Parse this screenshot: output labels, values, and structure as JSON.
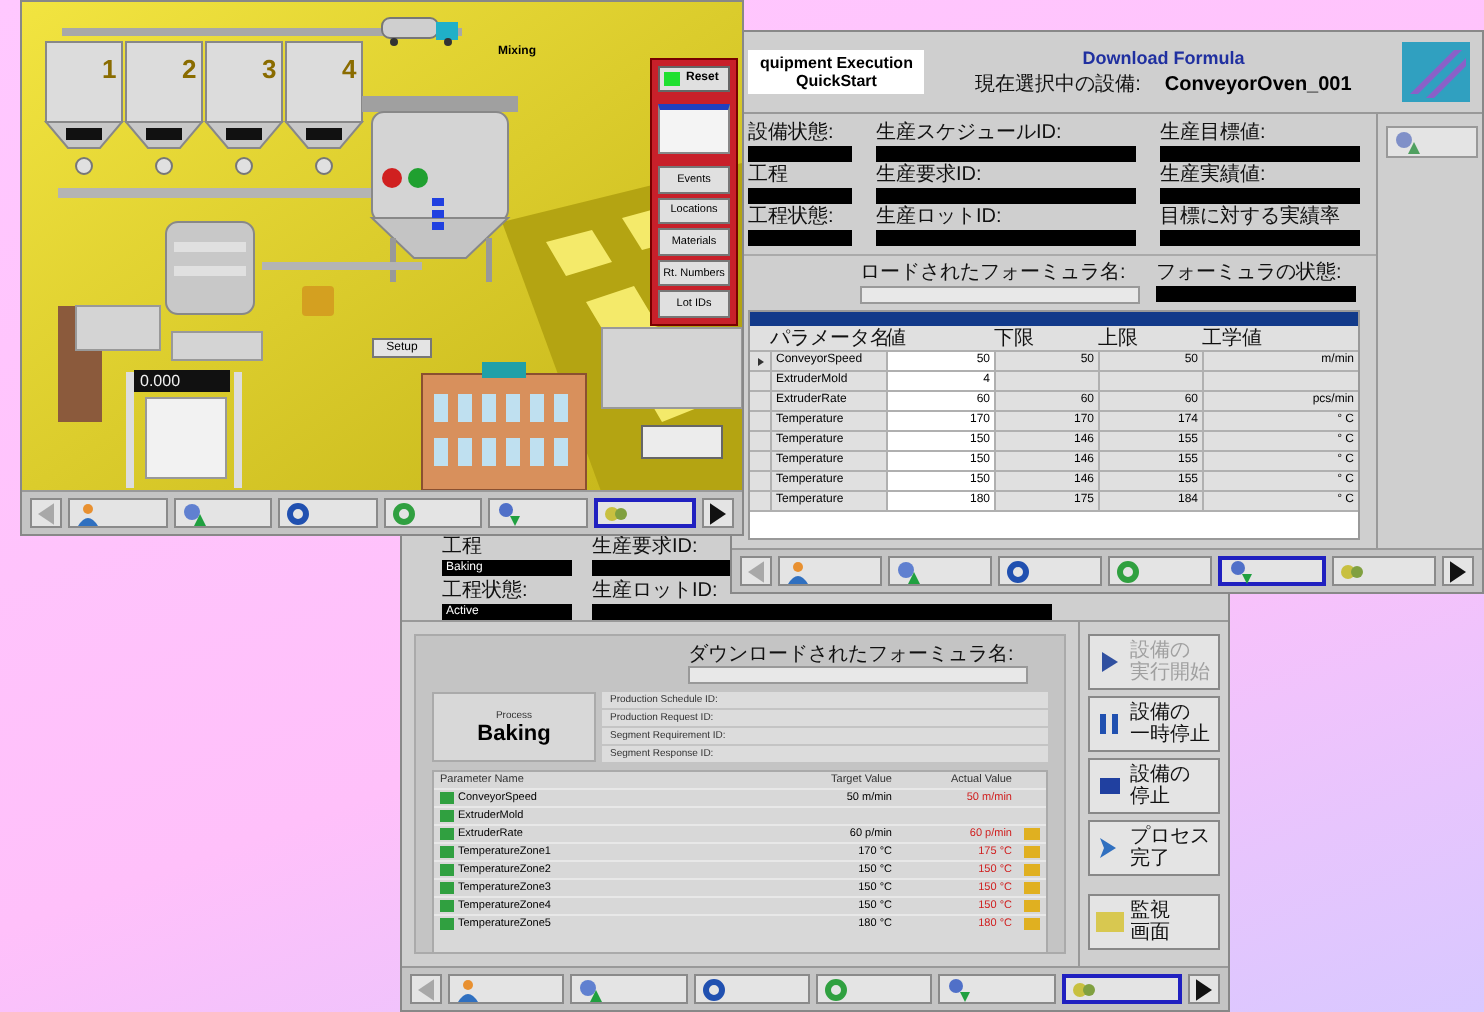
{
  "hmi": {
    "silos": [
      {
        "number": "1"
      },
      {
        "number": "2"
      },
      {
        "number": "3"
      },
      {
        "number": "4"
      }
    ],
    "mixer_label": "Mixing",
    "reset": {
      "label": "Reset",
      "on": true
    },
    "menu": [
      "Events",
      "Locations",
      "Materials",
      "Rt. Numbers",
      "Lot IDs"
    ],
    "setup_button": "Setup",
    "scale_reading": "0.000",
    "toolbar": {
      "back_disabled": true,
      "buttons": [
        {
          "kind": "home",
          "selected": false
        },
        {
          "kind": "manage",
          "selected": false
        },
        {
          "kind": "equipment",
          "selected": false
        },
        {
          "kind": "edit",
          "selected": false
        },
        {
          "kind": "download",
          "selected": false
        },
        {
          "kind": "run",
          "selected": true
        }
      ]
    }
  },
  "formula": {
    "brand": [
      "quipment Execution",
      "QuickStart"
    ],
    "title": "Download Formula",
    "current_label": "現在選択中の設備:",
    "current_equipment": "ConveyorOven_001",
    "field_columns": [
      [
        {
          "label": "設備状態:"
        },
        {
          "label": "工程"
        },
        {
          "label": "工程状態:"
        }
      ],
      [
        {
          "label": "生産スケジュールID:"
        },
        {
          "label": "生産要求ID:"
        },
        {
          "label": "生産ロットID:"
        }
      ],
      [
        {
          "label": "生産目標値:"
        },
        {
          "label": "生産実績値:"
        },
        {
          "label": "目標に対する実績率"
        }
      ]
    ],
    "formula_name_label": "ロードされたフォーミュラ名:",
    "formula_state_label": "フォーミュラの状態:",
    "table": {
      "columns": [
        "パラメータ名",
        "値",
        "下限",
        "上限",
        "工学値"
      ],
      "rows": [
        {
          "selected": true,
          "cells": [
            "ConveyorSpeed",
            "50",
            "50",
            "50",
            "m/min"
          ]
        },
        {
          "selected": false,
          "cells": [
            "ExtruderMold",
            "4",
            null,
            null,
            null
          ]
        },
        {
          "selected": false,
          "cells": [
            "ExtruderRate",
            "60",
            "60",
            "60",
            "pcs/min"
          ]
        },
        {
          "selected": false,
          "cells": [
            "Temperature",
            "170",
            "170",
            "174",
            "° C"
          ]
        },
        {
          "selected": false,
          "cells": [
            "Temperature",
            "150",
            "146",
            "155",
            "° C"
          ]
        },
        {
          "selected": false,
          "cells": [
            "Temperature",
            "150",
            "146",
            "155",
            "° C"
          ]
        },
        {
          "selected": false,
          "cells": [
            "Temperature",
            "150",
            "146",
            "155",
            "° C"
          ]
        },
        {
          "selected": false,
          "cells": [
            "Temperature",
            "180",
            "175",
            "184",
            "° C"
          ]
        }
      ]
    },
    "toolbar": {
      "back_disabled": true,
      "buttons": [
        {
          "kind": "home",
          "selected": false
        },
        {
          "kind": "manage",
          "selected": false
        },
        {
          "kind": "equipment",
          "selected": false
        },
        {
          "kind": "edit",
          "selected": false
        },
        {
          "kind": "download",
          "selected": true
        },
        {
          "kind": "run",
          "selected": false
        }
      ]
    }
  },
  "process": {
    "fields": [
      {
        "label": "工程",
        "value": "Baking"
      },
      {
        "label": "工程状態:",
        "value": "Active"
      }
    ],
    "id_fields": [
      {
        "label": "生産要求ID:"
      },
      {
        "label": "生産ロットID:"
      }
    ],
    "downloaded_label": "ダウンロードされたフォーミュラ名:",
    "process_caption": "Process",
    "process_name": "Baking",
    "info": [
      {
        "label": "Production Schedule ID:"
      },
      {
        "label": "Production Request ID:"
      },
      {
        "label": "Segment Requirement ID:"
      },
      {
        "label": "Segment Response ID:"
      }
    ],
    "table": {
      "columns": [
        "Parameter Name",
        "Target Value",
        "Actual Value"
      ],
      "rows": [
        {
          "name": "ConveyorSpeed",
          "target": "50 m/min",
          "actual": "50 m/min",
          "alarm": false
        },
        {
          "name": "ExtruderMold",
          "alarm": false
        },
        {
          "name": "ExtruderRate",
          "target": "60 p/min",
          "actual": "60 p/min",
          "alarm": true
        },
        {
          "name": "TemperatureZone1",
          "target": "170 °C",
          "actual": "175 °C",
          "alarm": true
        },
        {
          "name": "TemperatureZone2",
          "target": "150 °C",
          "actual": "150 °C",
          "alarm": true
        },
        {
          "name": "TemperatureZone3",
          "target": "150 °C",
          "actual": "150 °C",
          "alarm": true
        },
        {
          "name": "TemperatureZone4",
          "target": "150 °C",
          "actual": "150 °C",
          "alarm": true
        },
        {
          "name": "TemperatureZone5",
          "target": "180 °C",
          "actual": "180 °C",
          "alarm": true
        }
      ]
    },
    "side_buttons": [
      {
        "kind": "start",
        "lines": [
          "設備の",
          "実行開始"
        ],
        "disabled": true
      },
      {
        "kind": "pause",
        "lines": [
          "設備の",
          "一時停止"
        ],
        "disabled": false
      },
      {
        "kind": "stop",
        "lines": [
          "設備の",
          "停止"
        ],
        "disabled": false
      },
      {
        "kind": "complete",
        "lines": [
          "プロセス",
          "完了"
        ],
        "disabled": false
      },
      {
        "kind": "monitor",
        "lines": [
          "監視",
          "画面"
        ],
        "disabled": false
      }
    ],
    "toolbar": {
      "back_disabled": true,
      "buttons": [
        {
          "kind": "home",
          "selected": false
        },
        {
          "kind": "manage",
          "selected": false
        },
        {
          "kind": "equipment",
          "selected": false
        },
        {
          "kind": "edit",
          "selected": false
        },
        {
          "kind": "download",
          "selected": false
        },
        {
          "kind": "run",
          "selected": true
        }
      ]
    }
  }
}
